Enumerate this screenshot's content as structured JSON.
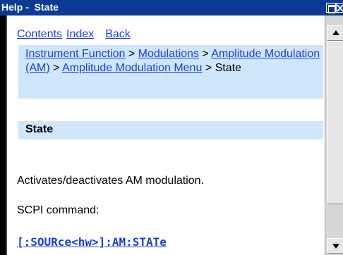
{
  "window": {
    "title": "Help -  State"
  },
  "nav": {
    "contents": "Contents",
    "index": "Index",
    "back": "Back"
  },
  "breadcrumb": {
    "item1": "Instrument Function",
    "sep1": " > ",
    "item2": "Modulations",
    "sep2": " > ",
    "item3": "Amplitude Modulation (AM)",
    "sep3": " > ",
    "item4": "Amplitude Modulation Menu",
    "sep4": " > ",
    "current": "State"
  },
  "section": {
    "heading": "State",
    "description": "Activates/deactivates AM modulation.",
    "scpi_label": "SCPI command:",
    "scpi_command": "[:SOURce<hw>]:AM:STATe"
  },
  "colors": {
    "titlebar": "#0a3a92",
    "link": "#1a3fd6",
    "highlight_box": "#cfe6fb"
  },
  "icons": {
    "maximize": "maximize-icon",
    "close": "close-icon",
    "scroll_up": "arrow-up-icon",
    "scroll_down": "arrow-down-icon"
  }
}
